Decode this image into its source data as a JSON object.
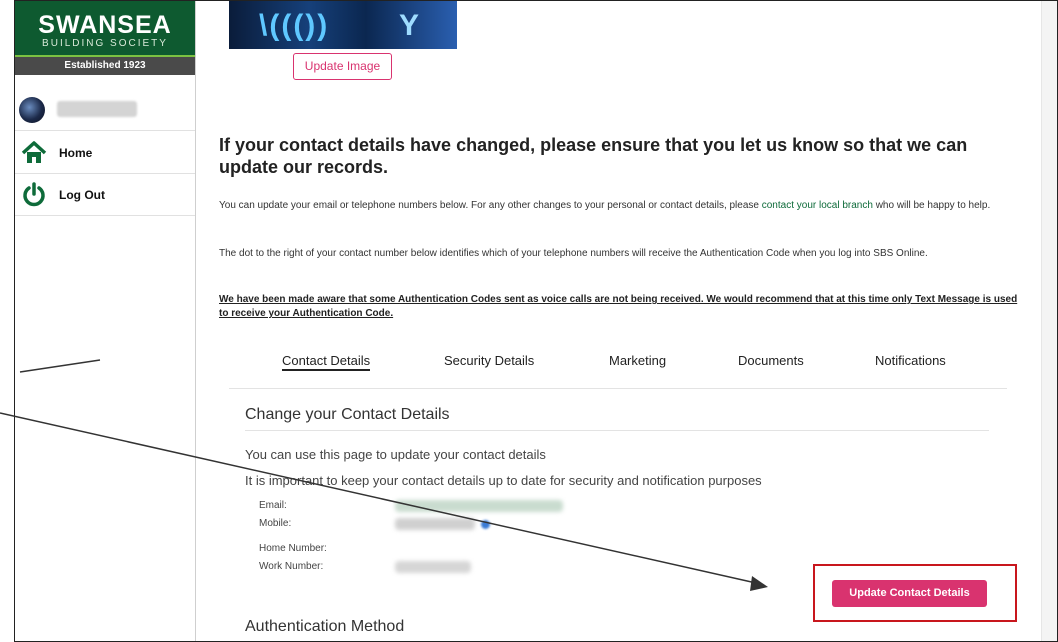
{
  "brand": {
    "name": "SWANSEA",
    "subtitle": "BUILDING SOCIETY",
    "established": "Established 1923",
    "colors": {
      "green": "#0e5a30",
      "accent_pink": "#d9336f",
      "highlight_red": "#c8161d"
    }
  },
  "sidebar": {
    "items": [
      {
        "label": "Home",
        "icon": "home-icon"
      },
      {
        "label": "Log Out",
        "icon": "power-icon"
      }
    ]
  },
  "profile": {
    "update_image_label": "Update Image"
  },
  "main": {
    "headline": "If your contact details have changed, please ensure that you let us know so that we can update our records.",
    "intro_before_link": "You can update your email or telephone numbers below. For any other changes to your personal or contact details, please ",
    "intro_link": "contact your local branch",
    "intro_after_link": " who will be happy to help.",
    "auth_note": "The dot to the right of your contact number below identifies which of your telephone numbers will receive the Authentication Code when you log into SBS Online.",
    "warning": "We have been made aware that some Authentication Codes sent as voice calls are not being received. We would recommend that at this time only Text Message is used to receive your Authentication Code."
  },
  "tabs": [
    {
      "label": "Contact Details",
      "active": true
    },
    {
      "label": "Security Details",
      "active": false
    },
    {
      "label": "Marketing",
      "active": false
    },
    {
      "label": "Documents",
      "active": false
    },
    {
      "label": "Notifications",
      "active": false
    }
  ],
  "contact": {
    "title": "Change your Contact Details",
    "line1": "You can use this page to update your contact details",
    "line2": "It is important to keep your contact details up to date for security and notification purposes",
    "fields": [
      {
        "label": "Email:"
      },
      {
        "label": "Mobile:"
      },
      {
        "label": "Home Number:"
      },
      {
        "label": "Work Number:"
      }
    ],
    "update_button": "Update Contact Details"
  },
  "auth_section": {
    "title": "Authentication Method"
  }
}
